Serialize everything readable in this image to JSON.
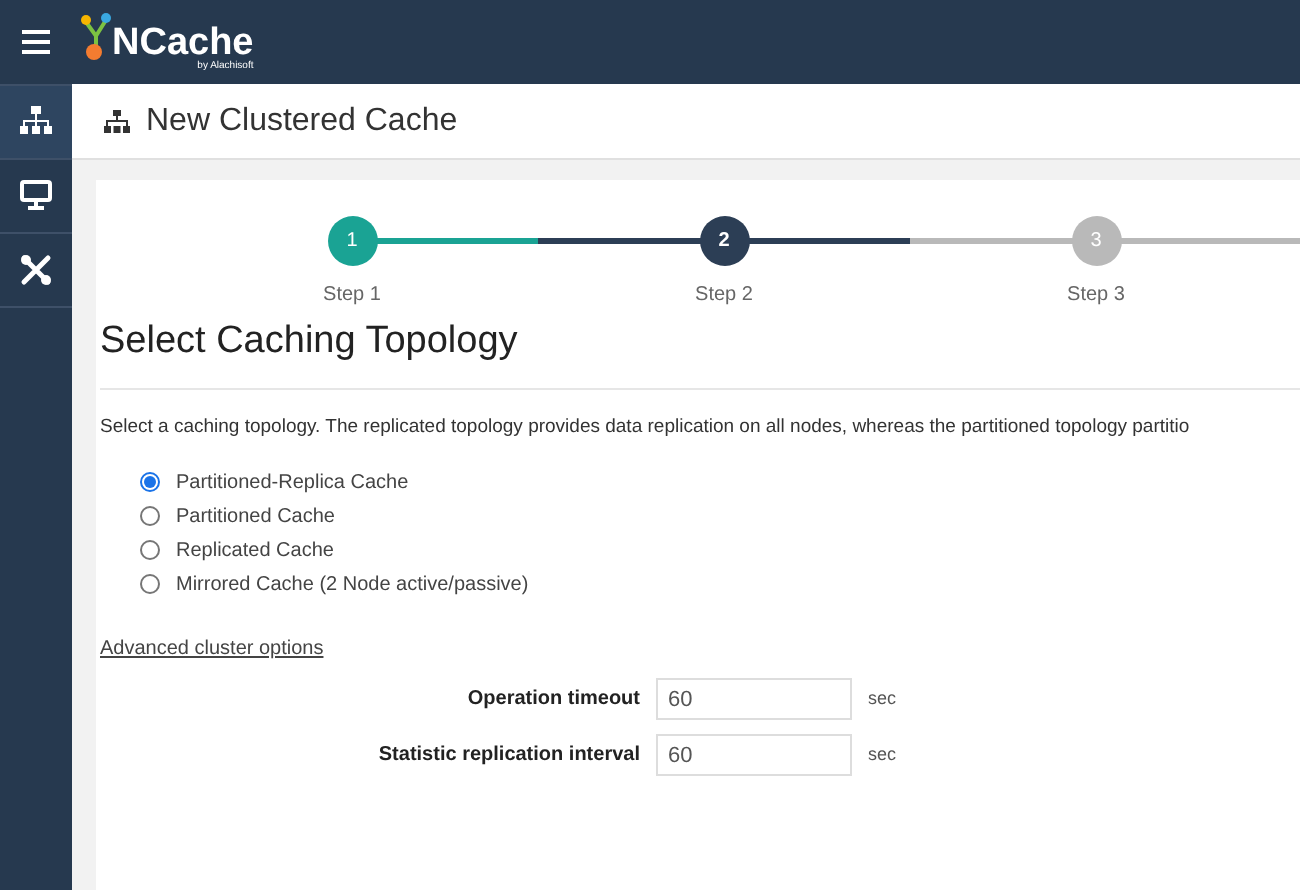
{
  "app": {
    "logo_text": "NCache",
    "logo_subtext": "by Alachisoft"
  },
  "sidebar": {
    "items": [
      {
        "selected": true
      },
      {
        "selected": false
      },
      {
        "selected": false
      }
    ]
  },
  "page": {
    "title": "New Clustered Cache"
  },
  "steps": [
    {
      "number": "1",
      "label": "Step 1",
      "completed": true,
      "selected": false
    },
    {
      "number": "2",
      "label": "Step 2",
      "completed": false,
      "selected": true
    },
    {
      "number": "3",
      "label": "Step 3",
      "completed": false,
      "selected": false
    }
  ],
  "section": {
    "heading": "Select Caching Topology",
    "description": "Select a caching topology. The replicated topology provides data replication on all nodes, whereas the partitioned topology partitio"
  },
  "topologies": [
    {
      "label": "Partitioned-Replica Cache",
      "selected": true
    },
    {
      "label": "Partitioned Cache",
      "selected": false
    },
    {
      "label": "Replicated Cache",
      "selected": false
    },
    {
      "label": "Mirrored Cache (2 Node active/passive)",
      "selected": false
    }
  ],
  "advanced_link": "Advanced cluster options",
  "fields": [
    {
      "label": "Operation timeout",
      "value": "60",
      "unit": "sec"
    },
    {
      "label": "Statistic replication interval",
      "value": "60",
      "unit": "sec"
    }
  ]
}
